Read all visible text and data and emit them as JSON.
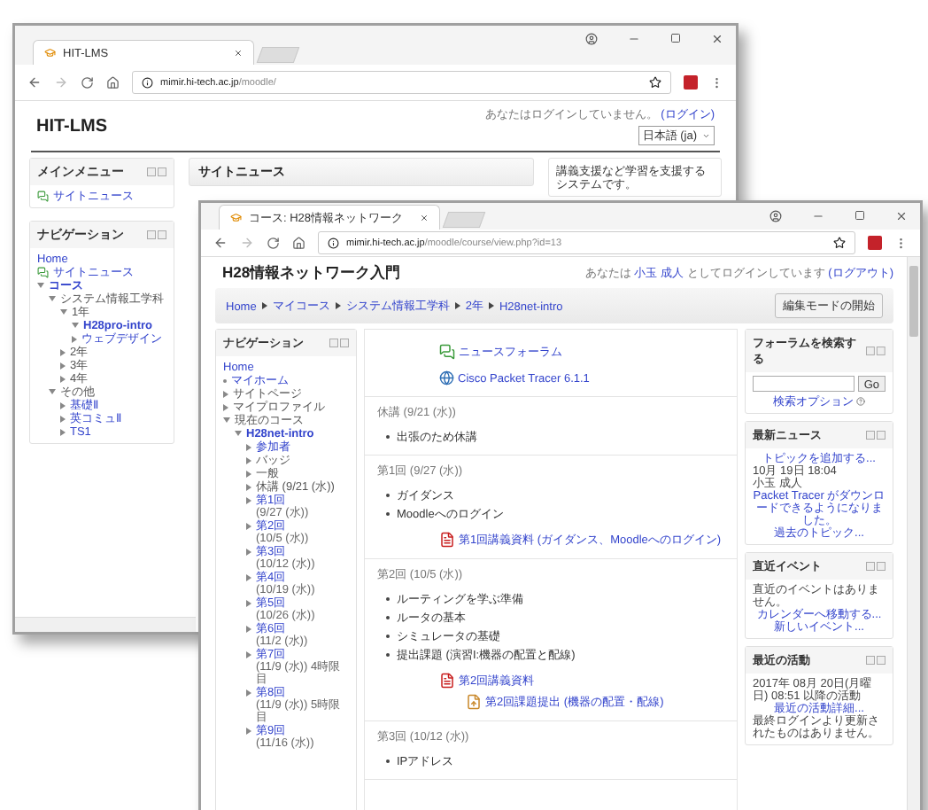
{
  "back_window": {
    "tab": {
      "title": "HIT-LMS"
    },
    "address": {
      "host": "mimir.hi-tech.ac.jp",
      "path": "/moodle/"
    },
    "site_title": "HIT-LMS",
    "login": {
      "notice": "あなたはログインしていません。",
      "link": "(ログイン)"
    },
    "language": "日本語 (ja)",
    "main_menu": {
      "title": "メインメニュー",
      "items": [
        {
          "label": "サイトニュース"
        }
      ]
    },
    "navigation": {
      "title": "ナビゲーション",
      "items": [
        {
          "kind": "leaf",
          "label": "Home",
          "link": true
        },
        {
          "kind": "page",
          "label": "サイトニュース",
          "link": true
        },
        {
          "kind": "branch",
          "label": "コース",
          "link": true,
          "expanded": true,
          "children": [
            {
              "kind": "branch",
              "label": "システム情報工学科",
              "link": false,
              "expanded": true,
              "children": [
                {
                  "kind": "branch",
                  "label": "1年",
                  "link": false,
                  "expanded": true,
                  "children": [
                    {
                      "kind": "branch",
                      "label": "H28pro-intro",
                      "link": true,
                      "expanded": true
                    },
                    {
                      "kind": "branch",
                      "label": "ウェブデザイン",
                      "link": true,
                      "expanded": false
                    }
                  ]
                },
                {
                  "kind": "branch",
                  "label": "2年",
                  "link": false,
                  "expanded": false
                },
                {
                  "kind": "branch",
                  "label": "3年",
                  "link": false,
                  "expanded": false
                },
                {
                  "kind": "branch",
                  "label": "4年",
                  "link": false,
                  "expanded": false
                }
              ]
            },
            {
              "kind": "branch",
              "label": "その他",
              "link": false,
              "expanded": true,
              "children": [
                {
                  "kind": "branch",
                  "label": "基礎Ⅱ",
                  "link": true,
                  "expanded": false
                },
                {
                  "kind": "branch",
                  "label": "英コミュⅡ",
                  "link": true,
                  "expanded": false
                },
                {
                  "kind": "branch",
                  "label": "TS1",
                  "link": true,
                  "expanded": false
                }
              ]
            }
          ]
        }
      ]
    },
    "site_news": {
      "title": "サイトニュース"
    },
    "about": "講義支援など学習を支援するシステムです。"
  },
  "front_window": {
    "tab": {
      "title": "コース: H28情報ネットワーク"
    },
    "address": {
      "host": "mimir.hi-tech.ac.jp",
      "path": "/moodle/course/view.php?id=13"
    },
    "course_title": "H28情報ネットワーク入門",
    "login": {
      "prefix": "あなたは",
      "user": "小玉 成人",
      "suffix": "としてログインしています",
      "link": "(ログアウト)"
    },
    "breadcrumb": [
      "Home",
      "マイコース",
      "システム情報工学科",
      "2年",
      "H28net-intro"
    ],
    "edit_button": "編集モードの開始",
    "navigation": {
      "title": "ナビゲーション",
      "items": [
        {
          "kind": "leaf",
          "label": "Home",
          "link": true
        },
        {
          "kind": "bullet",
          "label": "マイホーム",
          "link": true
        },
        {
          "kind": "branch",
          "label": "サイトページ",
          "link": false,
          "expanded": false
        },
        {
          "kind": "branch",
          "label": "マイプロファイル",
          "link": false,
          "expanded": false
        },
        {
          "kind": "branch",
          "label": "現在のコース",
          "link": false,
          "expanded": true,
          "children": [
            {
              "kind": "branch",
              "label": "H28net-intro",
              "link": true,
              "expanded": true,
              "children": [
                {
                  "kind": "branch",
                  "label": "参加者",
                  "link": true,
                  "expanded": false
                },
                {
                  "kind": "branch",
                  "label": "バッジ",
                  "link": false,
                  "expanded": false
                },
                {
                  "kind": "branch",
                  "label": "一般",
                  "link": false,
                  "expanded": false
                },
                {
                  "kind": "branch",
                  "label": "休講 (9/21 (水))",
                  "link": false,
                  "expanded": false
                },
                {
                  "kind": "branch",
                  "label": "第1回",
                  "note": "(9/27 (水))",
                  "link": true,
                  "expanded": false
                },
                {
                  "kind": "branch",
                  "label": "第2回",
                  "note": "(10/5 (水))",
                  "link": true,
                  "expanded": false
                },
                {
                  "kind": "branch",
                  "label": "第3回",
                  "note": "(10/12 (水))",
                  "link": true,
                  "expanded": false
                },
                {
                  "kind": "branch",
                  "label": "第4回",
                  "note": "(10/19 (水))",
                  "link": true,
                  "expanded": false
                },
                {
                  "kind": "branch",
                  "label": "第5回",
                  "note": "(10/26 (水))",
                  "link": true,
                  "expanded": false
                },
                {
                  "kind": "branch",
                  "label": "第6回",
                  "note": "(11/2 (水))",
                  "link": true,
                  "expanded": false
                },
                {
                  "kind": "branch",
                  "label": "第7回",
                  "note": "(11/9 (水)) 4時限目",
                  "link": true,
                  "expanded": false
                },
                {
                  "kind": "branch",
                  "label": "第8回",
                  "note": "(11/9 (水)) 5時限目",
                  "link": true,
                  "expanded": false
                },
                {
                  "kind": "branch",
                  "label": "第9回",
                  "note": "(11/16 (水))",
                  "link": true,
                  "expanded": false
                }
              ]
            }
          ]
        }
      ]
    },
    "sections": [
      {
        "resources": [
          {
            "kind": "forum",
            "label": "ニュースフォーラム",
            "indented": false
          },
          {
            "kind": "url",
            "label": "Cisco Packet Tracer 6.1.1",
            "indented": false
          }
        ]
      },
      {
        "title": "休講 (9/21 (水))",
        "bullets": [
          "出張のため休講"
        ]
      },
      {
        "title": "第1回 (9/27 (水))",
        "bullets": [
          "ガイダンス",
          "Moodleへのログイン"
        ],
        "resources": [
          {
            "kind": "pdf",
            "label": "第1回講義資料 (ガイダンス、Moodleへのログイン)",
            "indented": false
          }
        ]
      },
      {
        "title": "第2回 (10/5 (水))",
        "bullets": [
          "ルーティングを学ぶ準備",
          "ルータの基本",
          "シミュレータの基礎",
          "提出課題 (演習I:機器の配置と配線)"
        ],
        "resources": [
          {
            "kind": "pdf",
            "label": "第2回講義資料",
            "indented": false
          },
          {
            "kind": "assignment",
            "label": "第2回課題提出 (機器の配置・配線)",
            "indented": true
          }
        ]
      },
      {
        "title": "第3回 (10/12 (水))",
        "bullets": [
          "IPアドレス"
        ]
      }
    ],
    "blocks": [
      {
        "kind": "search",
        "title": "フォーラムを検索する",
        "button": "Go",
        "link": "検索オプション"
      },
      {
        "kind": "list",
        "title": "最新ニュース",
        "lines": [
          {
            "kind": "link",
            "text": "トピックを追加する..."
          },
          {
            "kind": "text",
            "text": "10月 19日 18:04"
          },
          {
            "kind": "text",
            "text": "小玉 成人"
          },
          {
            "kind": "link",
            "text": "Packet Tracer がダウンロードできるようになりました。"
          },
          {
            "kind": "link",
            "text": "過去のトピック..."
          }
        ]
      },
      {
        "kind": "list",
        "title": "直近イベント",
        "lines": [
          {
            "kind": "text",
            "text": "直近のイベントはありません。"
          },
          {
            "kind": "link",
            "text": "カレンダーへ移動する..."
          },
          {
            "kind": "link",
            "text": "新しいイベント..."
          }
        ]
      },
      {
        "kind": "list",
        "title": "最近の活動",
        "lines": [
          {
            "kind": "text",
            "text": "2017年 08月 20日(月曜日) 08:51 以降の活動"
          },
          {
            "kind": "link",
            "text": "最近の活動詳細..."
          },
          {
            "kind": "text",
            "text": "最終ログインより更新されたものはありません。"
          }
        ]
      }
    ]
  }
}
